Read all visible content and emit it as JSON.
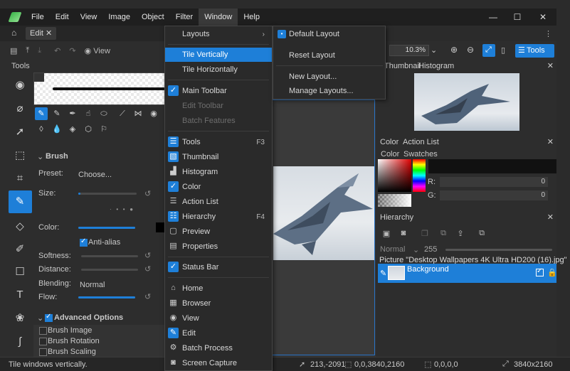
{
  "titlebar": {
    "menus": [
      "File",
      "Edit",
      "View",
      "Image",
      "Object",
      "Filter",
      "Window",
      "Help"
    ],
    "controls": {
      "minimize": "—",
      "maximize": "☐",
      "close": "✕"
    }
  },
  "doc_toolbar": {
    "tab_label": "Edit",
    "view_label": "View"
  },
  "tools_panel": {
    "title": "Tools",
    "brush_section": "Brush",
    "preset_label": "Preset:",
    "preset_value": "Choose...",
    "size_label": "Size:",
    "color_label": "Color:",
    "antialias_label": "Anti-alias",
    "softness_label": "Softness:",
    "distance_label": "Distance:",
    "blending_label": "Blending:",
    "blending_value": "Normal",
    "flow_label": "Flow:",
    "advanced_label": "Advanced Options",
    "advanced_items": [
      "Brush Image",
      "Brush Rotation",
      "Brush Scaling"
    ]
  },
  "window_menu": {
    "items": [
      {
        "label": "Layouts",
        "submenu": true
      },
      {
        "label": "Tile Vertically",
        "highlighted": true
      },
      {
        "label": "Tile Horizontally"
      },
      {
        "label": "Main Toolbar",
        "checked": true
      },
      {
        "label": "Edit Toolbar",
        "disabled": true
      },
      {
        "label": "Batch Features",
        "disabled": true
      },
      {
        "label": "Tools",
        "shortcut": "F3",
        "checked": true
      },
      {
        "label": "Thumbnail",
        "checked": true
      },
      {
        "label": "Histogram"
      },
      {
        "label": "Color",
        "checked": true
      },
      {
        "label": "Action List"
      },
      {
        "label": "Hierarchy",
        "shortcut": "F4",
        "checked": true
      },
      {
        "label": "Preview"
      },
      {
        "label": "Properties"
      },
      {
        "label": "Status Bar",
        "checked": true
      },
      {
        "label": "Home"
      },
      {
        "label": "Browser"
      },
      {
        "label": "View"
      },
      {
        "label": "Edit",
        "checked": true
      },
      {
        "label": "Batch Process"
      },
      {
        "label": "Screen Capture"
      }
    ]
  },
  "layouts_submenu": {
    "items": [
      "Default Layout",
      "Reset Layout",
      "New Layout...",
      "Manage Layouts..."
    ]
  },
  "right_toolbar": {
    "zoom": "10.3%",
    "tools_button": "Tools"
  },
  "thumbnail_panel": {
    "tabs": [
      "Thumbnail",
      "Histogram"
    ]
  },
  "color_panel": {
    "tabs": [
      "Color",
      "Action List"
    ],
    "subtabs": [
      "Color",
      "Swatches"
    ],
    "r_label": "R:",
    "r_value": "0",
    "g_label": "G:",
    "g_value": "0"
  },
  "hierarchy_panel": {
    "title": "Hierarchy",
    "blend_mode": "Normal",
    "opacity": "255",
    "picture_label": "Picture \"Desktop Wallpapers 4K Ultra HD200 (16).jpg\"",
    "layer_name": "Background"
  },
  "statusbar": {
    "message": "Tile windows vertically.",
    "cursor": "213,-2091",
    "selection": "0,0,3840,2160",
    "origin": "0,0,0,0",
    "size": "3840x2160"
  },
  "colors": {
    "accent": "#1e7fd8",
    "menu_bg": "#2a2a2a",
    "panel_bg": "#2d2d2d"
  }
}
